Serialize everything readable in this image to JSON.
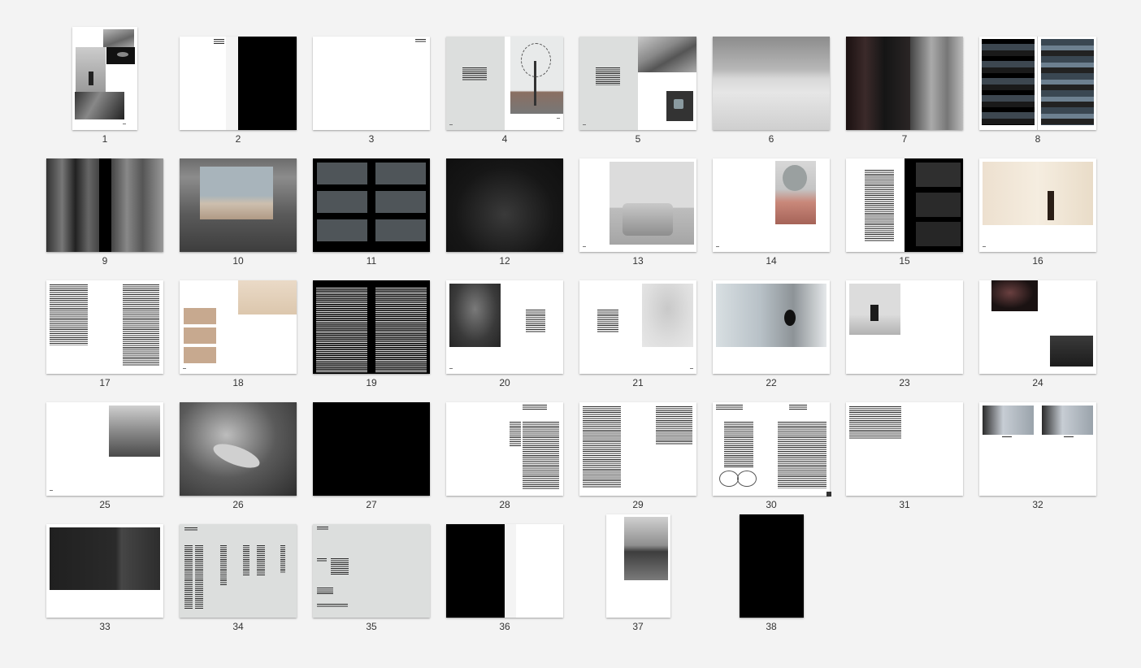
{
  "pages": [
    {
      "label": "1"
    },
    {
      "label": "2"
    },
    {
      "label": "3"
    },
    {
      "label": "4"
    },
    {
      "label": "5"
    },
    {
      "label": "6"
    },
    {
      "label": "7"
    },
    {
      "label": "8"
    },
    {
      "label": "9"
    },
    {
      "label": "10"
    },
    {
      "label": "11"
    },
    {
      "label": "12"
    },
    {
      "label": "13"
    },
    {
      "label": "14"
    },
    {
      "label": "15"
    },
    {
      "label": "16"
    },
    {
      "label": "17"
    },
    {
      "label": "18"
    },
    {
      "label": "19"
    },
    {
      "label": "20"
    },
    {
      "label": "21"
    },
    {
      "label": "22"
    },
    {
      "label": "23"
    },
    {
      "label": "24"
    },
    {
      "label": "25"
    },
    {
      "label": "26"
    },
    {
      "label": "27"
    },
    {
      "label": "28"
    },
    {
      "label": "29"
    },
    {
      "label": "30"
    },
    {
      "label": "31"
    },
    {
      "label": "32"
    },
    {
      "label": "33"
    },
    {
      "label": "34"
    },
    {
      "label": "35"
    },
    {
      "label": "36"
    },
    {
      "label": "37"
    },
    {
      "label": "38"
    }
  ],
  "colors": {
    "background": "#f3f3f3",
    "label_text": "#333333",
    "page_white": "#ffffff",
    "page_black": "#000000",
    "page_gray": "#dcdedd"
  }
}
